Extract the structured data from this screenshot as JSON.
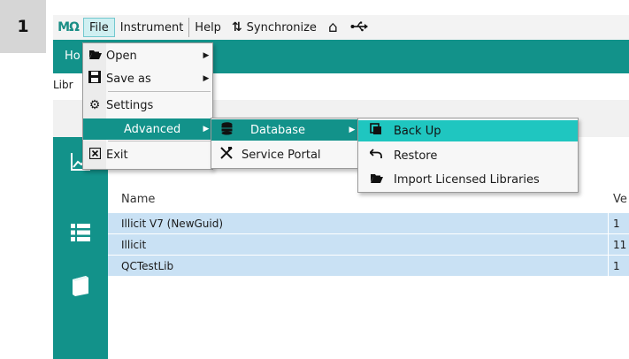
{
  "step": "1",
  "menubar": {
    "logo": "MΩ",
    "items": [
      "File",
      "Instrument",
      "Help"
    ],
    "sync_label": "Synchronize",
    "home_icon": "home-icon",
    "usb_icon": "usb-icon"
  },
  "header": {
    "tab_label": "Ho"
  },
  "subbar": {
    "label": "Libr"
  },
  "file_menu": {
    "items": [
      {
        "label": "Open",
        "icon": "folder-open-icon",
        "submenu": true
      },
      {
        "label": "Save as",
        "icon": "floppy-disk-icon",
        "submenu": true
      },
      {
        "label": "Settings",
        "icon": "gear-icon",
        "submenu": false
      },
      {
        "label": "Advanced",
        "icon": "",
        "submenu": true
      },
      {
        "label": "Exit",
        "icon": "exit-box-icon",
        "submenu": false
      }
    ]
  },
  "advanced_menu": {
    "items": [
      {
        "label": "Database",
        "icon": "database-icon",
        "submenu": true
      },
      {
        "label": "Service Portal",
        "icon": "tools-icon",
        "submenu": false
      }
    ]
  },
  "database_menu": {
    "items": [
      {
        "label": "Back Up",
        "icon": "copy-icon"
      },
      {
        "label": "Restore",
        "icon": "undo-arrow-icon"
      },
      {
        "label": "Import Licensed Libraries",
        "icon": "folder-open-icon"
      }
    ]
  },
  "grid": {
    "columns": [
      "Name",
      "Ve"
    ],
    "rows": [
      {
        "name": "Illicit V7 (NewGuid)",
        "version": "1"
      },
      {
        "name": "Illicit",
        "version": "11"
      },
      {
        "name": "QCTestLib",
        "version": "1"
      }
    ]
  },
  "colors": {
    "teal": "#12928a",
    "highlight": "#1fc6c0",
    "row_selected": "#c9e1f4"
  }
}
